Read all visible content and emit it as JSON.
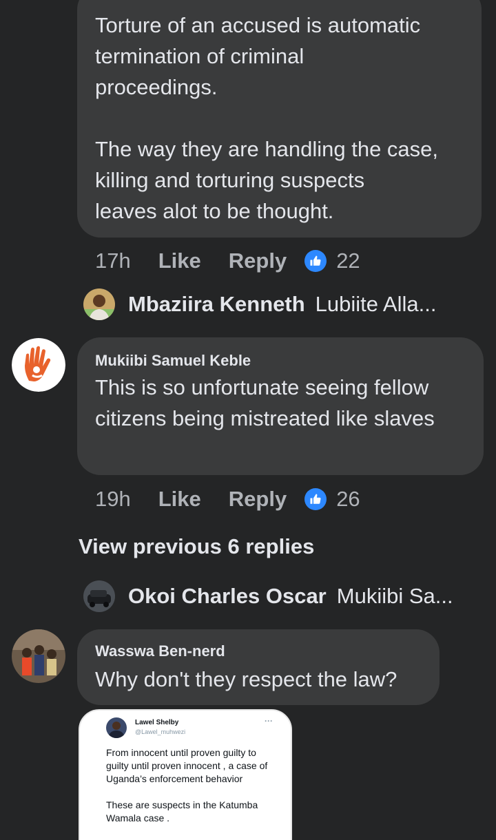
{
  "comment1": {
    "text": "Torture of an accused is automatic termination of criminal\nproceedings.\n\nThe way they are handling the case, killing and torturing suspects\nleaves alot to be thought.",
    "time": "17h",
    "like_label": "Like",
    "reply_label": "Reply",
    "reactions": "22"
  },
  "reply_preview1": {
    "name": "Mbaziira Kenneth",
    "snippet": "Lubiite Alla..."
  },
  "comment2": {
    "author": "Mukiibi Samuel Keble",
    "text": "This is so unfortunate seeing fellow citizens being mistreated like slaves",
    "time": "19h",
    "like_label": "Like",
    "reply_label": "Reply",
    "reactions": "26"
  },
  "view_previous": "View previous 6 replies",
  "reply_preview2": {
    "name": "Okoi Charles Oscar",
    "snippet": "Mukiibi Sa..."
  },
  "comment3": {
    "author": "Wasswa Ben-nerd",
    "text": "Why don't they respect the law?"
  },
  "tweet": {
    "name": "Lawel Shelby",
    "handle": "@Lawel_muhwezi",
    "more": "···",
    "body": "From innocent until proven guilty to guilty until proven innocent , a case of Uganda’s enforcement behavior\n\nThese are suspects in the Katumba Wamala case ."
  },
  "colors": {
    "background": "#242526",
    "bubble": "#3a3b3c",
    "text": "#e4e6eb",
    "secondary_text": "#b0b3b8",
    "like_badge": "#2d88ff"
  }
}
